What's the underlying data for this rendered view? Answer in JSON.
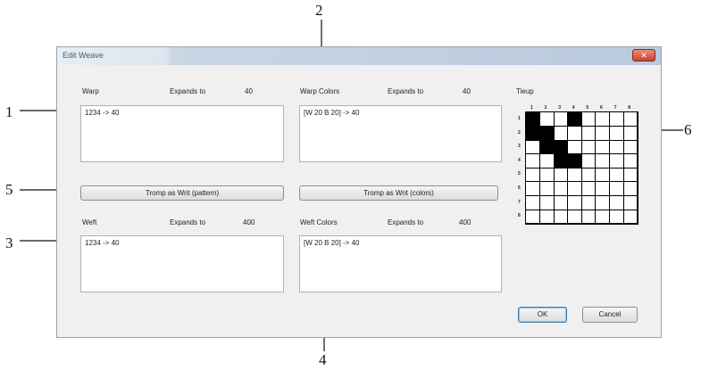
{
  "callouts": [
    "1",
    "2",
    "3",
    "4",
    "5",
    "6"
  ],
  "window": {
    "title": "Edit Weave",
    "close_icon": "close-icon"
  },
  "warp": {
    "label": "Warp",
    "expands_label": "Expands to",
    "expands_value": "40",
    "text": "1234 -> 40"
  },
  "warp_colors": {
    "label": "Warp Colors",
    "expands_label": "Expands to",
    "expands_value": "40",
    "text": "[W 20 B 20] -> 40"
  },
  "buttons": {
    "tromp_pattern": "Tromp as Writ (pattern)",
    "tromp_colors": "Tromp as Writ (colors)",
    "ok": "OK",
    "cancel": "Cancel"
  },
  "weft": {
    "label": "Weft",
    "expands_label": "Expands to",
    "expands_value": "400",
    "text": "1234 -> 40"
  },
  "weft_colors": {
    "label": "Weft Colors",
    "expands_label": "Expands to",
    "expands_value": "400",
    "text": "[W 20 B 20] -> 40"
  },
  "tieup": {
    "label": "Tieup",
    "col_labels": [
      "1",
      "2",
      "3",
      "4",
      "5",
      "6",
      "7",
      "8"
    ],
    "row_labels": [
      "1",
      "2",
      "3",
      "4",
      "5",
      "6",
      "7",
      "8"
    ],
    "filled": [
      [
        1,
        1
      ],
      [
        1,
        4
      ],
      [
        2,
        1
      ],
      [
        2,
        2
      ],
      [
        3,
        2
      ],
      [
        3,
        3
      ],
      [
        4,
        3
      ],
      [
        4,
        4
      ]
    ]
  }
}
